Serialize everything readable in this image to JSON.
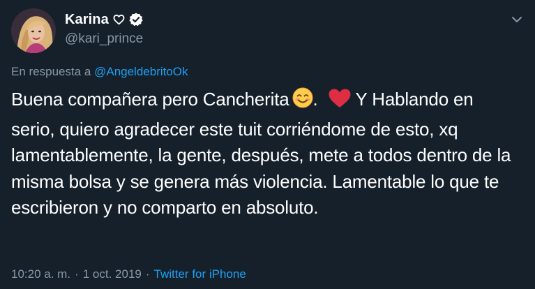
{
  "tweet": {
    "author": {
      "display_name": "Karina",
      "handle": "@kari_prince",
      "heart_icon": "heart-outline-icon",
      "verified_icon": "verified-badge-icon"
    },
    "reply": {
      "prefix": "En respuesta a",
      "mention": "@AngeldebritoOk"
    },
    "text": {
      "part1": "Buena compañera pero Cancherita",
      "after_smile": ".",
      "after_heart": "Y Hablando en serio, quiero agradecer este tuit corriéndome de esto, xq lamentablemente, la gente, después, mete a todos dentro de la misma bolsa y se genera más violencia. Lamentable lo que te escribieron y no comparto en absoluto.",
      "emojis": [
        "smiling-face-emoji",
        "red-heart-emoji"
      ]
    },
    "footer": {
      "time": "10:20 a. m.",
      "separator1": "·",
      "date": "1 oct. 2019",
      "separator2": "·",
      "source": "Twitter for iPhone"
    },
    "menu_icon": "chevron-down-icon"
  },
  "colors": {
    "background": "#15202b",
    "text_primary": "#ffffff",
    "text_secondary": "#8899a6",
    "link": "#1da1f2",
    "verified_badge": "#ffffff"
  }
}
